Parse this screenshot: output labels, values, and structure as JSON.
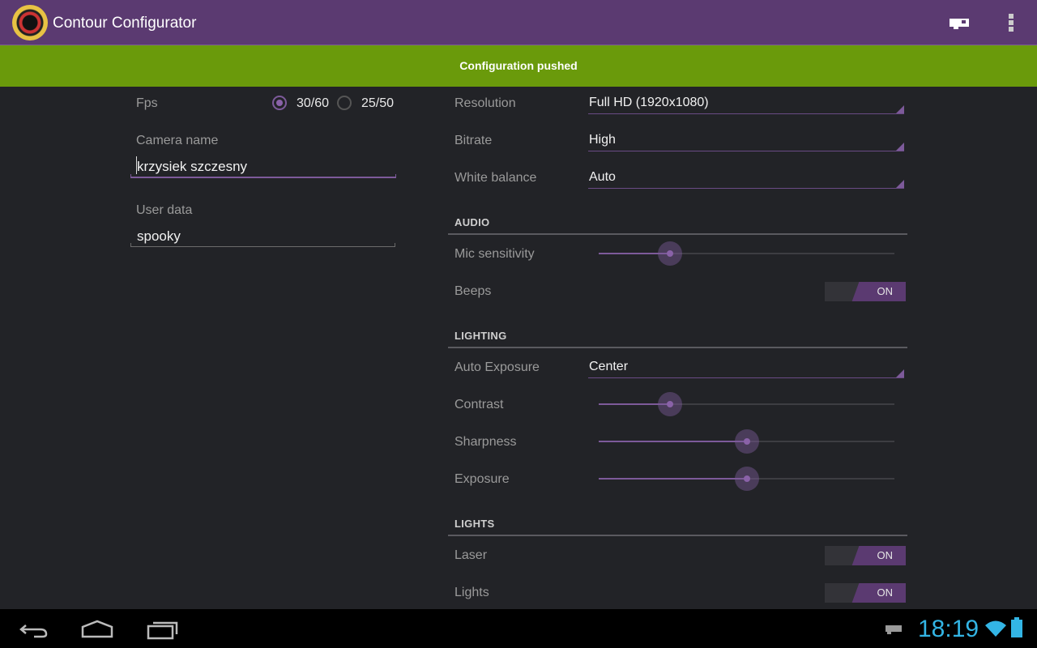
{
  "app": {
    "title": "Contour Configurator",
    "icon": "camera-lens-icon"
  },
  "actionbar": {
    "icons": [
      "camera-icon",
      "overflow-menu-icon"
    ]
  },
  "banner": {
    "text": "Configuration pushed"
  },
  "left": {
    "fps": {
      "label": "Fps",
      "options": [
        "30/60",
        "25/50"
      ],
      "selected": "30/60"
    },
    "camera_name": {
      "label": "Camera name",
      "value": "krzysiek szczesny"
    },
    "user_data": {
      "label": "User data",
      "value": "spooky"
    }
  },
  "video": {
    "resolution": {
      "label": "Resolution",
      "value": "Full HD (1920x1080)"
    },
    "bitrate": {
      "label": "Bitrate",
      "value": "High"
    },
    "white_balance": {
      "label": "White balance",
      "value": "Auto"
    }
  },
  "audio": {
    "title": "AUDIO",
    "mic": {
      "label": "Mic sensitivity",
      "level": 0.24
    },
    "beeps": {
      "label": "Beeps",
      "state": "ON"
    }
  },
  "lighting": {
    "title": "LIGHTING",
    "auto_exposure": {
      "label": "Auto Exposure",
      "value": "Center"
    },
    "contrast": {
      "label": "Contrast",
      "level": 0.24
    },
    "sharpness": {
      "label": "Sharpness",
      "level": 0.5
    },
    "exposure": {
      "label": "Exposure",
      "level": 0.5
    }
  },
  "lights": {
    "title": "LIGHTS",
    "laser": {
      "label": "Laser",
      "state": "ON"
    },
    "lights": {
      "label": "Lights",
      "state": "ON"
    }
  },
  "statusbar": {
    "time": "18:19"
  },
  "colors": {
    "accent": "#5b3a71",
    "banner": "#6a9a0b",
    "clock": "#33b5e5"
  }
}
